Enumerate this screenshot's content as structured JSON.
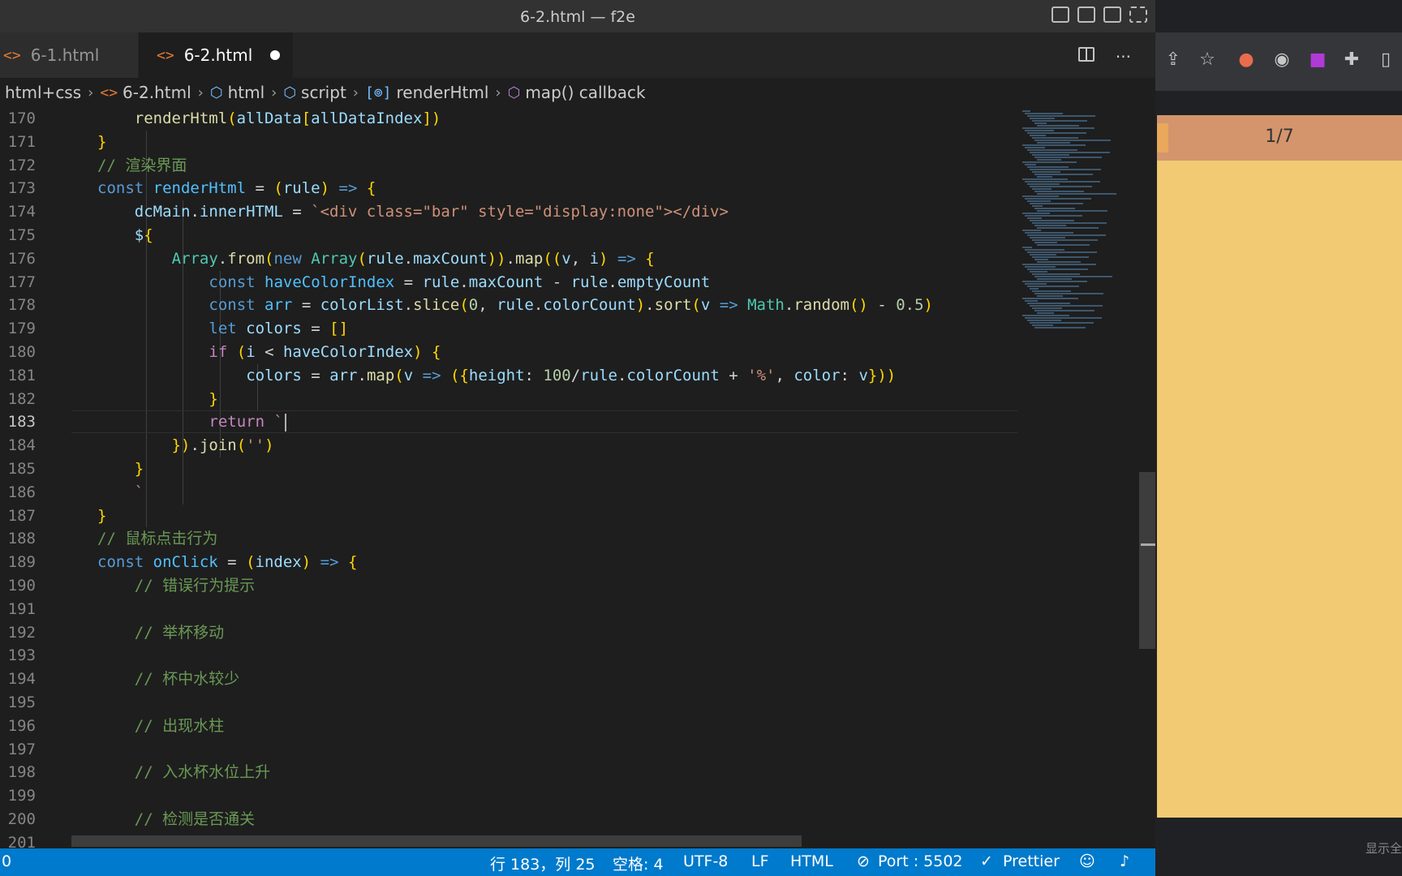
{
  "window": {
    "title": "6-2.html — f2e"
  },
  "tabs": [
    {
      "label": "6-1.html",
      "icon": "html-file-icon",
      "active": false
    },
    {
      "label": "6-2.html",
      "icon": "html-file-icon",
      "active": true,
      "dirty": true
    }
  ],
  "editor_actions": {
    "more": "···"
  },
  "breadcrumb": [
    "html+css",
    "6-2.html",
    "html",
    "script",
    "renderHtml",
    "map() callback"
  ],
  "code": {
    "active_line": 183,
    "lines": [
      {
        "n": "170",
        "text": "renderHtml(allData[allDataIndex])"
      },
      {
        "n": "171",
        "text": "}"
      },
      {
        "n": "172",
        "text": "// 渲染界面"
      },
      {
        "n": "173",
        "text": "const renderHtml = (rule) => {"
      },
      {
        "n": "174",
        "text": "dcMain.innerHTML = `<div class=\"bar\" style=\"display:none\"></div>"
      },
      {
        "n": "175",
        "text": "${"
      },
      {
        "n": "176",
        "text": "Array.from(new Array(rule.maxCount)).map((v, i) => {"
      },
      {
        "n": "177",
        "text": "const haveColorIndex = rule.maxCount - rule.emptyCount"
      },
      {
        "n": "178",
        "text": "const arr = colorList.slice(0, rule.colorCount).sort(v => Math.random() - 0.5)"
      },
      {
        "n": "179",
        "text": "let colors = []"
      },
      {
        "n": "180",
        "text": "if (i < haveColorIndex) {"
      },
      {
        "n": "181",
        "text": "colors = arr.map(v => ({height: 100/rule.colorCount + '%', color: v}))"
      },
      {
        "n": "182",
        "text": "}"
      },
      {
        "n": "183",
        "text": "return `"
      },
      {
        "n": "184",
        "text": "}).join('')"
      },
      {
        "n": "185",
        "text": "}"
      },
      {
        "n": "186",
        "text": "`"
      },
      {
        "n": "187",
        "text": "}"
      },
      {
        "n": "188",
        "text": "// 鼠标点击行为"
      },
      {
        "n": "189",
        "text": "const onClick = (index) => {"
      },
      {
        "n": "190",
        "text": "// 错误行为提示"
      },
      {
        "n": "191",
        "text": ""
      },
      {
        "n": "192",
        "text": "// 举杯移动"
      },
      {
        "n": "193",
        "text": ""
      },
      {
        "n": "194",
        "text": "// 杯中水较少"
      },
      {
        "n": "195",
        "text": ""
      },
      {
        "n": "196",
        "text": "// 出现水柱"
      },
      {
        "n": "197",
        "text": ""
      },
      {
        "n": "198",
        "text": "// 入水杯水位上升"
      },
      {
        "n": "199",
        "text": ""
      },
      {
        "n": "200",
        "text": "// 检测是否通关"
      },
      {
        "n": "201",
        "text": ""
      }
    ]
  },
  "statusbar": {
    "left": "0",
    "position": "行 183，列 25",
    "indent": "空格: 4",
    "encoding": "UTF-8",
    "eol": "LF",
    "language": "HTML",
    "port": "Port : 5502",
    "prettier": "Prettier"
  },
  "browser": {
    "page_counter": "1/7",
    "bottom_text": "显示全",
    "page_colors": {
      "header": "#d4956c",
      "body": "#f2ca74"
    }
  }
}
